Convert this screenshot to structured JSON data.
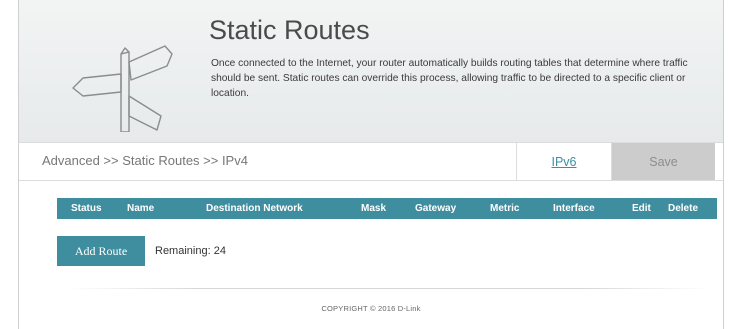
{
  "header": {
    "title": "Static Routes",
    "description": "Once connected to the Internet, your router automatically builds routing tables that determine where traffic should be sent. Static routes can override this process, allowing traffic to be directed to a specific client or location.",
    "icon": "signpost-icon"
  },
  "toolbar": {
    "breadcrumb": "Advanced >> Static Routes >> IPv4",
    "ipv6_label": "IPv6",
    "save_label": "Save"
  },
  "table": {
    "columns": [
      "Status",
      "Name",
      "Destination Network",
      "Mask",
      "Gateway",
      "Metric",
      "Interface",
      "Edit",
      "Delete"
    ]
  },
  "actions": {
    "add_route_label": "Add Route",
    "remaining_text": "Remaining: 24"
  },
  "footer": {
    "copyright": "COPYRIGHT © 2016 D-Link"
  },
  "colors": {
    "accent": "#3f8ea0",
    "save_disabled": "#cccccc",
    "link": "#3c8fa6"
  }
}
